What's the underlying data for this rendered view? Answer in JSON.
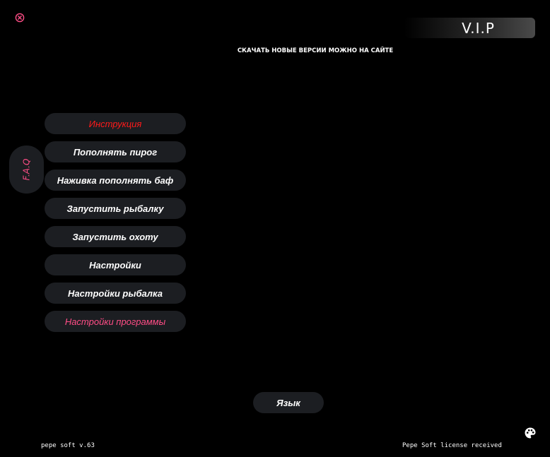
{
  "header": {
    "close_icon": "close-circle-icon",
    "vip_label": "V.I.P",
    "download_note": "СКАЧАТЬ НОВЫЕ ВЕРСИИ МОЖНО НА САЙТЕ"
  },
  "faq": {
    "label": "F.A.Q"
  },
  "menu": {
    "items": [
      {
        "label": "Инструкция"
      },
      {
        "label": "Пополнять пирог"
      },
      {
        "label": "Наживка пополнять баф"
      },
      {
        "label": "Запустить рыбалку"
      },
      {
        "label": "Запустить охоту"
      },
      {
        "label": "Настройки"
      },
      {
        "label": "Настройки рыбалка"
      },
      {
        "label": "Настройки программы"
      }
    ]
  },
  "language": {
    "label": "Язык"
  },
  "footer": {
    "version": "pepe soft v.63",
    "license": "Pepe Soft license received",
    "palette_icon": "palette-icon"
  },
  "colors": {
    "background": "#000000",
    "button_bg": "#1c1e22",
    "accent_red": "#ff1a1a",
    "accent_pink": "#ff4d86",
    "text": "#ffffff"
  }
}
